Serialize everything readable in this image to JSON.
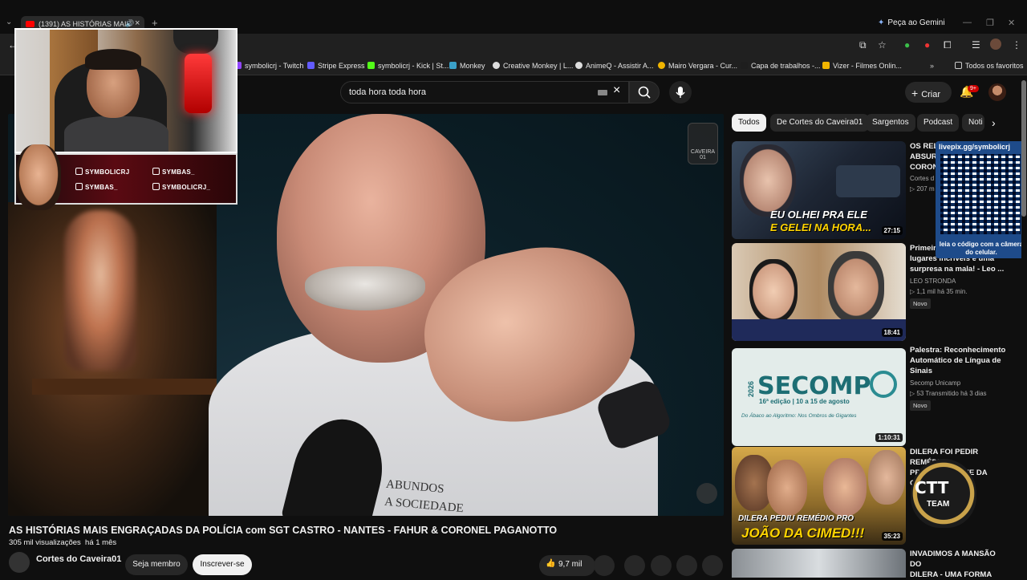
{
  "browser": {
    "tab_title": "(1391) AS HISTÓRIAS MAIS",
    "gemini_label": "Peça ao Gemini",
    "new_tab": "+"
  },
  "bookmarks": [
    {
      "label": "symbolicrj - Twitch",
      "color": "#9146ff"
    },
    {
      "label": "Stripe Express",
      "color": "#635bff"
    },
    {
      "label": "symbolicrj - Kick | St...",
      "color": "#53fc18"
    },
    {
      "label": "Monkey",
      "color": "#3aa0c8"
    },
    {
      "label": "Creative Monkey | L...",
      "color": "#dddddd"
    },
    {
      "label": "AnimeQ - Assistir A...",
      "color": "#dddddd"
    },
    {
      "label": "Mairo Vergara - Cur...",
      "color": "#f0b400"
    },
    {
      "label": "Capa de trabalhos -...",
      "color": "#1e1e1e"
    },
    {
      "label": "Vizer - Filmes Onlin...",
      "color": "#f0b400"
    }
  ],
  "bookmarks_all": "Todos os favoritos",
  "header": {
    "search_value": "toda hora toda hora",
    "create_label": "Criar",
    "notif_count": "9+"
  },
  "overlay": {
    "socials": [
      {
        "icon": "twitch-icon",
        "label": "SYMBOLICRJ"
      },
      {
        "icon": "tiktok-icon",
        "label": "SYMBAS_"
      },
      {
        "icon": "youtube-icon",
        "label": "SYMBAS_"
      },
      {
        "icon": "instagram-icon",
        "label": "SYMBOLICRJ_"
      }
    ],
    "qr_url": "livepix.gg/symbolicrj",
    "qr_hint": "leia o código com a câmera do celular.",
    "ctt_logo": "CTT",
    "ctt_sub": "TEAM"
  },
  "video": {
    "watermark": "CAVEIRA 01",
    "shirt_text_1": "ABUNDOS",
    "shirt_text_2": "A SOCIEDADE",
    "title": "AS HISTÓRIAS MAIS ENGRAÇADAS DA POLÍCIA com SGT CASTRO - NANTES - FAHUR & CORONEL PAGANOTTO",
    "views": "305 mil visualizações",
    "age": "há 1 mês",
    "channel": "Cortes do Caveira01",
    "join_label": "Seja membro",
    "subscribe_label": "Inscrever-se",
    "likes": "9,7 mil"
  },
  "chips": [
    "Todos",
    "De Cortes do Caveira01",
    "Sargentos",
    "Podcast",
    "Noti"
  ],
  "related": [
    {
      "title_1": "OS REL",
      "title_2": "ABSUR",
      "title_3": "CORON",
      "channel": "Cortes d",
      "meta": "207 m",
      "duration": "27:15",
      "thumb_text_1": "EU OLHEI PRA ELE",
      "thumb_text_2": "E GELEI NA HORA..."
    },
    {
      "title_1": "Primeir",
      "title_2": "lugares incríveis e uma",
      "title_3": "surpresa na mala! - Leo ...",
      "channel": "LEO STRONDA",
      "meta": "1,1 mil  há 35 min.",
      "badge": "Novo",
      "duration": "18:41"
    },
    {
      "title_1": "Palestra: Reconhecimento",
      "title_2": "Automático de Língua de",
      "title_3": "Sinais",
      "channel": "Secomp Unicamp",
      "meta": "53  Transmitido há 3 dias",
      "badge": "Novo",
      "duration": "1:10:31",
      "thumb_year": "2026",
      "thumb_brand": "SECOMP",
      "thumb_edition": "16ª edição | 10 a 15 de agosto",
      "thumb_slogan": "Do Ábaco ao Algoritmo: Nos Ombros de Gigantes"
    },
    {
      "title_1": "DILERA FOI PEDIR REMÉDIO",
      "title_2": "PRO JOÃO DONE DA CIMED",
      "duration": "35:23",
      "thumb_text_1": "DILERA PEDIU REMÉDIO PRO",
      "thumb_text_2": "JOÃO DA CIMED!!!"
    },
    {
      "title_1": "INVADIMOS A MANSÃO DO",
      "title_2": "DILERA - UMA FORMA"
    }
  ]
}
